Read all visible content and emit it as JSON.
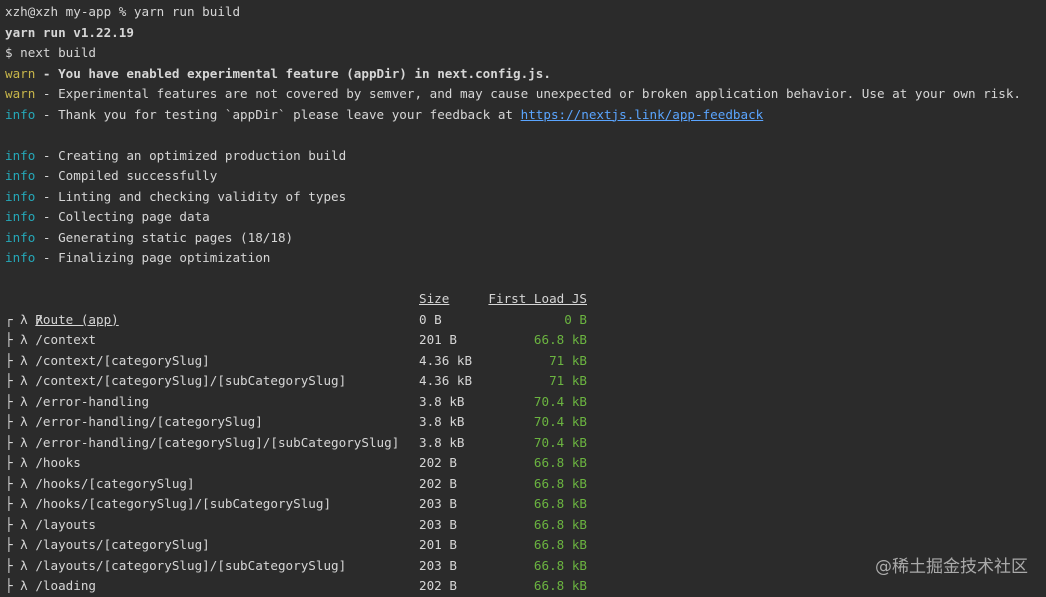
{
  "prompt": {
    "user_host": "xzh@xzh my-app %",
    "command": "yarn run build"
  },
  "header_lines": [
    "yarn run v1.22.19",
    "$ next build"
  ],
  "messages": [
    {
      "level": "warn",
      "text": " - You have enabled experimental feature (appDir) in next.config.js.",
      "bold": true
    },
    {
      "level": "warn",
      "text": " - Experimental features are not covered by semver, and may cause unexpected or broken application behavior. Use at your own risk.",
      "bold": false
    },
    {
      "level": "info",
      "text": " - Thank you for testing `appDir` please leave your feedback at ",
      "link": "https://nextjs.link/app-feedback"
    }
  ],
  "build_steps": [
    {
      "level": "info",
      "text": " - Creating an optimized production build"
    },
    {
      "level": "info",
      "text": " - Compiled successfully"
    },
    {
      "level": "info",
      "text": " - Linting and checking validity of types"
    },
    {
      "level": "info",
      "text": " - Collecting page data"
    },
    {
      "level": "info",
      "text": " - Generating static pages (18/18)"
    },
    {
      "level": "info",
      "text": " - Finalizing page optimization"
    }
  ],
  "table": {
    "headers": {
      "route": "Route (app)",
      "size": "Size",
      "load": "First Load JS"
    },
    "rows": [
      {
        "prefix": "┌ λ ",
        "route": "/",
        "size": "0 B",
        "load": "0 B"
      },
      {
        "prefix": "├ λ ",
        "route": "/context",
        "size": "201 B",
        "load": "66.8 kB"
      },
      {
        "prefix": "├ λ ",
        "route": "/context/[categorySlug]",
        "size": "4.36 kB",
        "load": "71 kB"
      },
      {
        "prefix": "├ λ ",
        "route": "/context/[categorySlug]/[subCategorySlug]",
        "size": "4.36 kB",
        "load": "71 kB"
      },
      {
        "prefix": "├ λ ",
        "route": "/error-handling",
        "size": "3.8 kB",
        "load": "70.4 kB"
      },
      {
        "prefix": "├ λ ",
        "route": "/error-handling/[categorySlug]",
        "size": "3.8 kB",
        "load": "70.4 kB"
      },
      {
        "prefix": "├ λ ",
        "route": "/error-handling/[categorySlug]/[subCategorySlug]",
        "size": "3.8 kB",
        "load": "70.4 kB"
      },
      {
        "prefix": "├ λ ",
        "route": "/hooks",
        "size": "202 B",
        "load": "66.8 kB"
      },
      {
        "prefix": "├ λ ",
        "route": "/hooks/[categorySlug]",
        "size": "202 B",
        "load": "66.8 kB"
      },
      {
        "prefix": "├ λ ",
        "route": "/hooks/[categorySlug]/[subCategorySlug]",
        "size": "203 B",
        "load": "66.8 kB"
      },
      {
        "prefix": "├ λ ",
        "route": "/layouts",
        "size": "203 B",
        "load": "66.8 kB"
      },
      {
        "prefix": "├ λ ",
        "route": "/layouts/[categorySlug]",
        "size": "201 B",
        "load": "66.8 kB"
      },
      {
        "prefix": "├ λ ",
        "route": "/layouts/[categorySlug]/[subCategorySlug]",
        "size": "203 B",
        "load": "66.8 kB"
      },
      {
        "prefix": "├ λ ",
        "route": "/loading",
        "size": "202 B",
        "load": "66.8 kB"
      }
    ]
  },
  "watermark": "@稀土掘金技术社区",
  "colors": {
    "background": "#2b2b2b",
    "text": "#d6d6d6",
    "warn": "#c8b64a",
    "info": "#25a8b8",
    "link": "#5aa5ff",
    "load_value": "#6bb440"
  }
}
